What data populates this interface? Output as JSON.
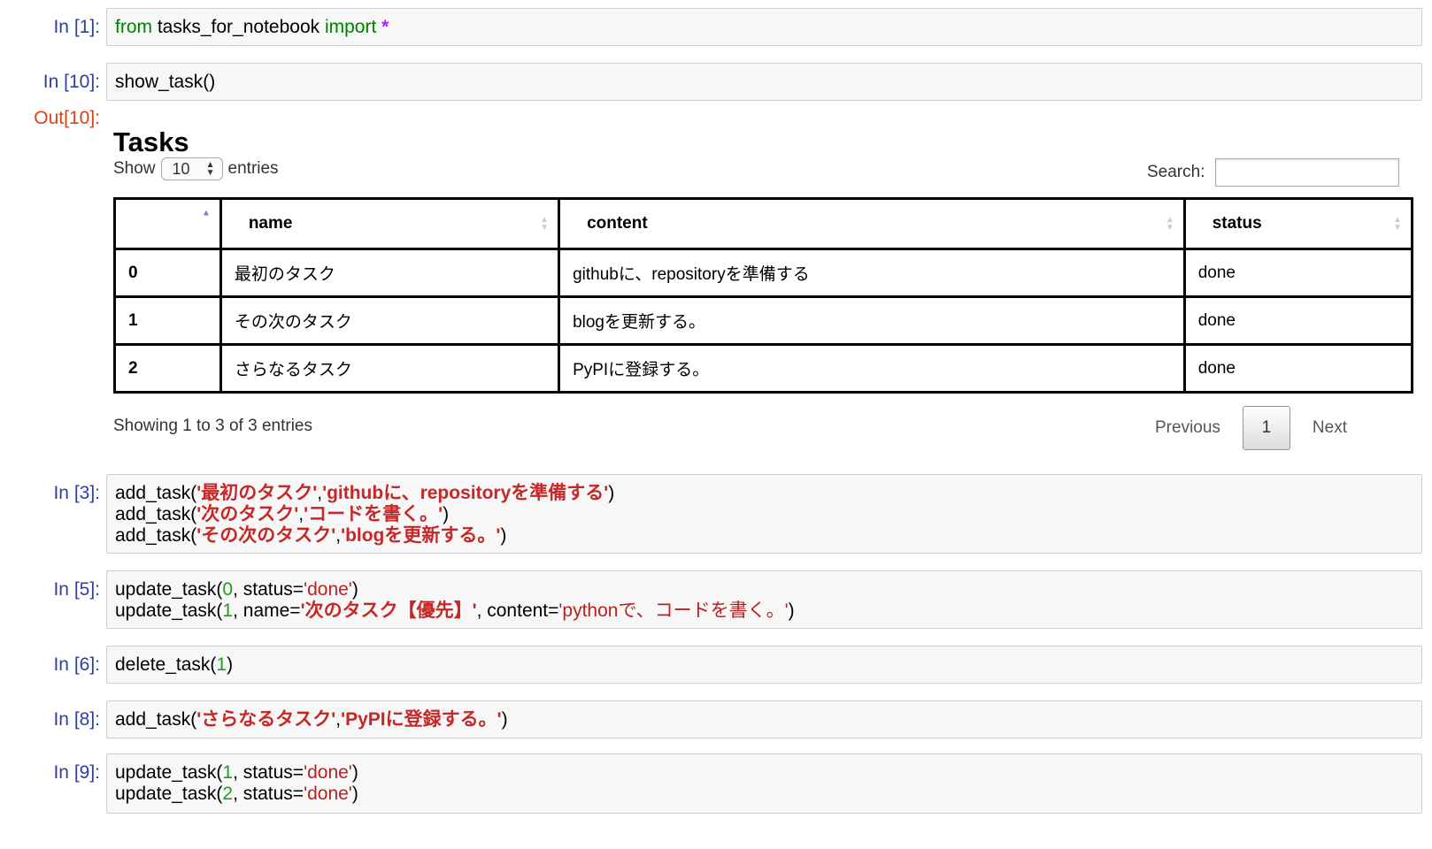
{
  "cells": [
    {
      "prompt": "In [1]:",
      "lines": [
        [
          {
            "t": "from",
            "c": "kw"
          },
          {
            "t": " tasks_for_notebook "
          },
          {
            "t": "import",
            "c": "kw"
          },
          {
            "t": " "
          },
          {
            "t": "*",
            "c": "op"
          }
        ]
      ]
    },
    {
      "prompt": "In [10]:",
      "lines": [
        [
          {
            "t": "show_task()"
          }
        ]
      ]
    },
    {
      "prompt": "In [3]:",
      "lines": [
        [
          {
            "t": "add_task("
          },
          {
            "t": "'最初のタスク'",
            "c": "bstr"
          },
          {
            "t": ","
          },
          {
            "t": "'githubに、repositoryを準備する'",
            "c": "bstr"
          },
          {
            "t": ")"
          }
        ],
        [
          {
            "t": "add_task("
          },
          {
            "t": "'次のタスク'",
            "c": "bstr"
          },
          {
            "t": ","
          },
          {
            "t": "'コードを書く。'",
            "c": "bstr"
          },
          {
            "t": ")"
          }
        ],
        [
          {
            "t": "add_task("
          },
          {
            "t": "'その次のタスク'",
            "c": "bstr"
          },
          {
            "t": ","
          },
          {
            "t": "'blogを更新する。'",
            "c": "bstr"
          },
          {
            "t": ")"
          }
        ]
      ]
    },
    {
      "prompt": "In [5]:",
      "lines": [
        [
          {
            "t": "update_task("
          },
          {
            "t": "0",
            "c": "num"
          },
          {
            "t": ", status="
          },
          {
            "t": "'done'",
            "c": "str"
          },
          {
            "t": ")"
          }
        ],
        [
          {
            "t": "update_task("
          },
          {
            "t": "1",
            "c": "num"
          },
          {
            "t": ", name="
          },
          {
            "t": "'次のタスク【優先】'",
            "c": "bstr"
          },
          {
            "t": ", content="
          },
          {
            "t": "'pythonで、コードを書く。'",
            "c": "str"
          },
          {
            "t": ")"
          }
        ]
      ]
    },
    {
      "prompt": "In [6]:",
      "lines": [
        [
          {
            "t": "delete_task("
          },
          {
            "t": "1",
            "c": "num"
          },
          {
            "t": ")"
          }
        ]
      ]
    },
    {
      "prompt": "In [8]:",
      "lines": [
        [
          {
            "t": "add_task("
          },
          {
            "t": "'さらなるタスク'",
            "c": "bstr"
          },
          {
            "t": ","
          },
          {
            "t": "'PyPIに登録する。'",
            "c": "bstr"
          },
          {
            "t": ")"
          }
        ]
      ]
    },
    {
      "prompt": "In [9]:",
      "lines": [
        [
          {
            "t": "update_task("
          },
          {
            "t": "1",
            "c": "num"
          },
          {
            "t": ", status="
          },
          {
            "t": "'done'",
            "c": "str"
          },
          {
            "t": ")"
          }
        ],
        [
          {
            "t": "update_task("
          },
          {
            "t": "2",
            "c": "num"
          },
          {
            "t": ", status="
          },
          {
            "t": "'done'",
            "c": "str"
          },
          {
            "t": ")"
          }
        ]
      ]
    }
  ],
  "output": {
    "prompt": "Out[10]:",
    "title": "Tasks",
    "show_label": "Show",
    "entries_value": "10",
    "entries_label": "entries",
    "search_label": "Search:",
    "columns": [
      "",
      "name",
      "content",
      "status"
    ],
    "rows": [
      [
        "0",
        "最初のタスク",
        "githubに、repositoryを準備する",
        "done"
      ],
      [
        "1",
        "その次のタスク",
        "blogを更新する。",
        "done"
      ],
      [
        "2",
        "さらなるタスク",
        "PyPIに登録する。",
        "done"
      ]
    ],
    "info": "Showing 1 to 3 of 3 entries",
    "prev": "Previous",
    "page": "1",
    "next": "Next"
  },
  "icons": {
    "sort": "sort-arrows-icon",
    "sort_asc": "sort-ascending-icon",
    "select": "select-arrows-icon"
  }
}
